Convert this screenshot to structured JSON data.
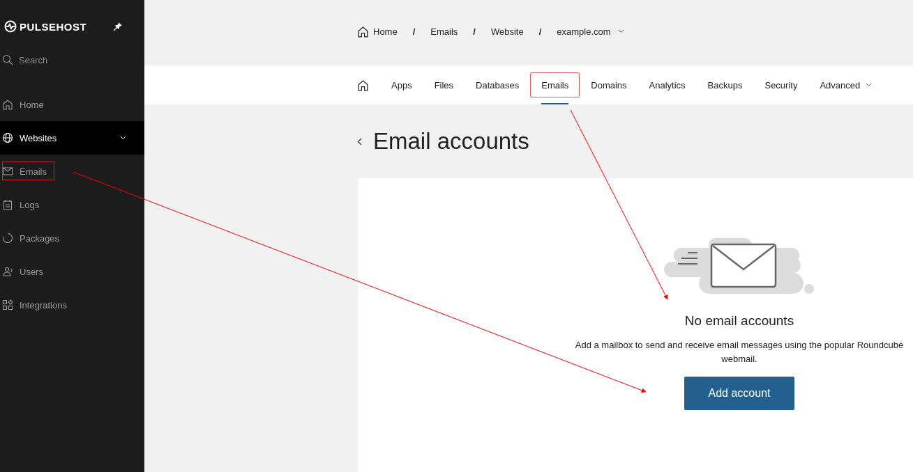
{
  "sidebar": {
    "brand": "PULSEHOST",
    "search": {
      "placeholder": "Search"
    },
    "items": [
      {
        "label": "Home",
        "selected": false,
        "expanded": false,
        "highlighted": false
      },
      {
        "label": "Websites",
        "selected": true,
        "expanded": true,
        "highlighted": false
      },
      {
        "label": "Emails",
        "selected": false,
        "expanded": false,
        "highlighted": true
      },
      {
        "label": "Logs",
        "selected": false,
        "expanded": false,
        "highlighted": false
      },
      {
        "label": "Packages",
        "selected": false,
        "expanded": false,
        "highlighted": false
      },
      {
        "label": "Users",
        "selected": false,
        "expanded": false,
        "highlighted": false
      },
      {
        "label": "Integrations",
        "selected": false,
        "expanded": false,
        "highlighted": false
      }
    ]
  },
  "breadcrumb": {
    "separator": "/",
    "items": [
      "Home",
      "Emails",
      "Website",
      "example.com"
    ]
  },
  "tabs": [
    {
      "label": "Apps",
      "selected": false,
      "highlighted": false,
      "dropdown": false
    },
    {
      "label": "Files",
      "selected": false,
      "highlighted": false,
      "dropdown": false
    },
    {
      "label": "Databases",
      "selected": false,
      "highlighted": false,
      "dropdown": false
    },
    {
      "label": "Emails",
      "selected": true,
      "highlighted": true,
      "dropdown": false
    },
    {
      "label": "Domains",
      "selected": false,
      "highlighted": false,
      "dropdown": false
    },
    {
      "label": "Analytics",
      "selected": false,
      "highlighted": false,
      "dropdown": false
    },
    {
      "label": "Backups",
      "selected": false,
      "highlighted": false,
      "dropdown": false
    },
    {
      "label": "Security",
      "selected": false,
      "highlighted": false,
      "dropdown": false
    },
    {
      "label": "Advanced",
      "selected": false,
      "highlighted": false,
      "dropdown": true
    }
  ],
  "page_title": "Email accounts",
  "empty_state": {
    "title": "No email accounts",
    "text": "Add a mailbox to send and receive email messages using the popular Roundcube webmail.",
    "button": "Add account"
  }
}
